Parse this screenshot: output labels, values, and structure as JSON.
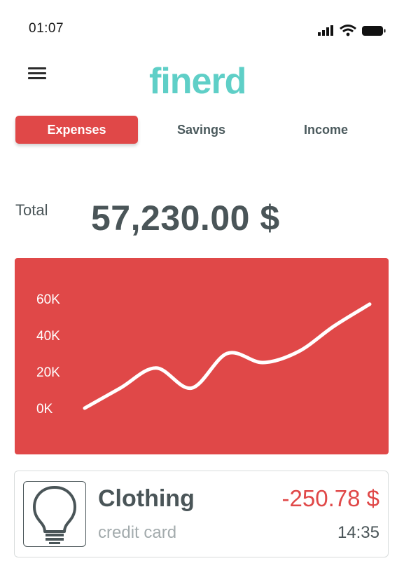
{
  "status_bar": {
    "time": "01:07",
    "icons": [
      "cellular-signal-icon",
      "wifi-icon",
      "battery-icon"
    ]
  },
  "header": {
    "menu_icon": "hamburger-menu-icon",
    "logo": "finerd"
  },
  "tabs": [
    {
      "label": "Expenses",
      "active": true
    },
    {
      "label": "Savings",
      "active": false
    },
    {
      "label": "Income",
      "active": false
    }
  ],
  "summary": {
    "total_label": "Total",
    "total_amount": "57,230.00 $"
  },
  "colors": {
    "accent_red": "#e04848",
    "brand_teal": "#5fcfc7",
    "text_dark": "#4a5558",
    "text_muted": "#a3abad"
  },
  "chart_data": {
    "type": "line",
    "title": "",
    "xlabel": "",
    "ylabel": "",
    "ylim": [
      0,
      60000
    ],
    "yticks": [
      "0K",
      "20K",
      "40K",
      "60K"
    ],
    "ytick_values": [
      0,
      20000,
      40000,
      60000
    ],
    "x": [
      0,
      1,
      2,
      3,
      4,
      5,
      6,
      7,
      8
    ],
    "series": [
      {
        "values": [
          0,
          11000,
          22000,
          11000,
          30000,
          25000,
          31000,
          45000,
          57000
        ]
      }
    ],
    "grid": false,
    "legend": "none"
  },
  "transactions": [
    {
      "icon": "lightbulb-icon",
      "category": "Clothing",
      "method": "credit card",
      "amount": "-250.78 $",
      "time": "14:35"
    }
  ]
}
